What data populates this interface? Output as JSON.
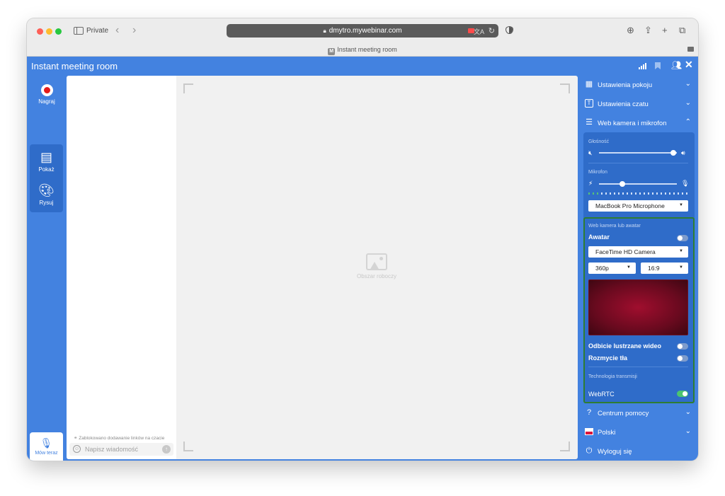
{
  "browser": {
    "mode_label": "Private",
    "url": "dmytro.mywebinar.com",
    "tab_title": "Instant meeting room",
    "tab_favicon_letter": "M",
    "toolbar_icons": [
      "sidebar-icon",
      "back-icon",
      "forward-icon",
      "lock-icon",
      "camera-indicator-icon",
      "translate-icon",
      "reload-icon",
      "shield-icon",
      "download-icon",
      "share-icon",
      "plus-icon",
      "tabs-icon"
    ]
  },
  "app": {
    "title": "Instant meeting room",
    "header_icons": [
      "signal-icon",
      "bookmark-icon",
      "people-icon",
      "close-icon"
    ]
  },
  "left_rail": {
    "record_label": "Nagraj",
    "tools": [
      {
        "icon": "presentation-icon",
        "label": "Pokaż"
      },
      {
        "icon": "palette-icon",
        "label": "Rysuj"
      }
    ],
    "speak_label": "Mów teraz"
  },
  "chat": {
    "notice": "Zablokowano dodawanie linków na czacie",
    "placeholder": "Napisz wiadomość"
  },
  "workspace": {
    "placeholder_label": "Obszar roboczy"
  },
  "panel": {
    "room_settings": "Ustawienia pokoju",
    "chat_settings": "Ustawienia czatu",
    "webcam_mic": "Web kamera i mikrofon",
    "volume_label": "Głośność",
    "volume_level": 0.95,
    "mic_label": "Mikrofon",
    "mic_level": 0.3,
    "mic_device": "MacBook Pro Microphone",
    "webcam_section": "Web kamera lub awatar",
    "avatar_label": "Awatar",
    "avatar_on": false,
    "camera_device": "FaceTime HD Camera",
    "resolution": "360p",
    "aspect": "16:9",
    "mirror_label": "Odbicie lustrzane wideo",
    "mirror_on": false,
    "blur_label": "Rozmycie tła",
    "blur_on": false,
    "tech_section": "Technologia transmisji",
    "webrtc_label": "WebRTC",
    "webrtc_on": true,
    "help_center": "Centrum pomocy",
    "language": "Polski",
    "logout": "Wyloguj się"
  }
}
